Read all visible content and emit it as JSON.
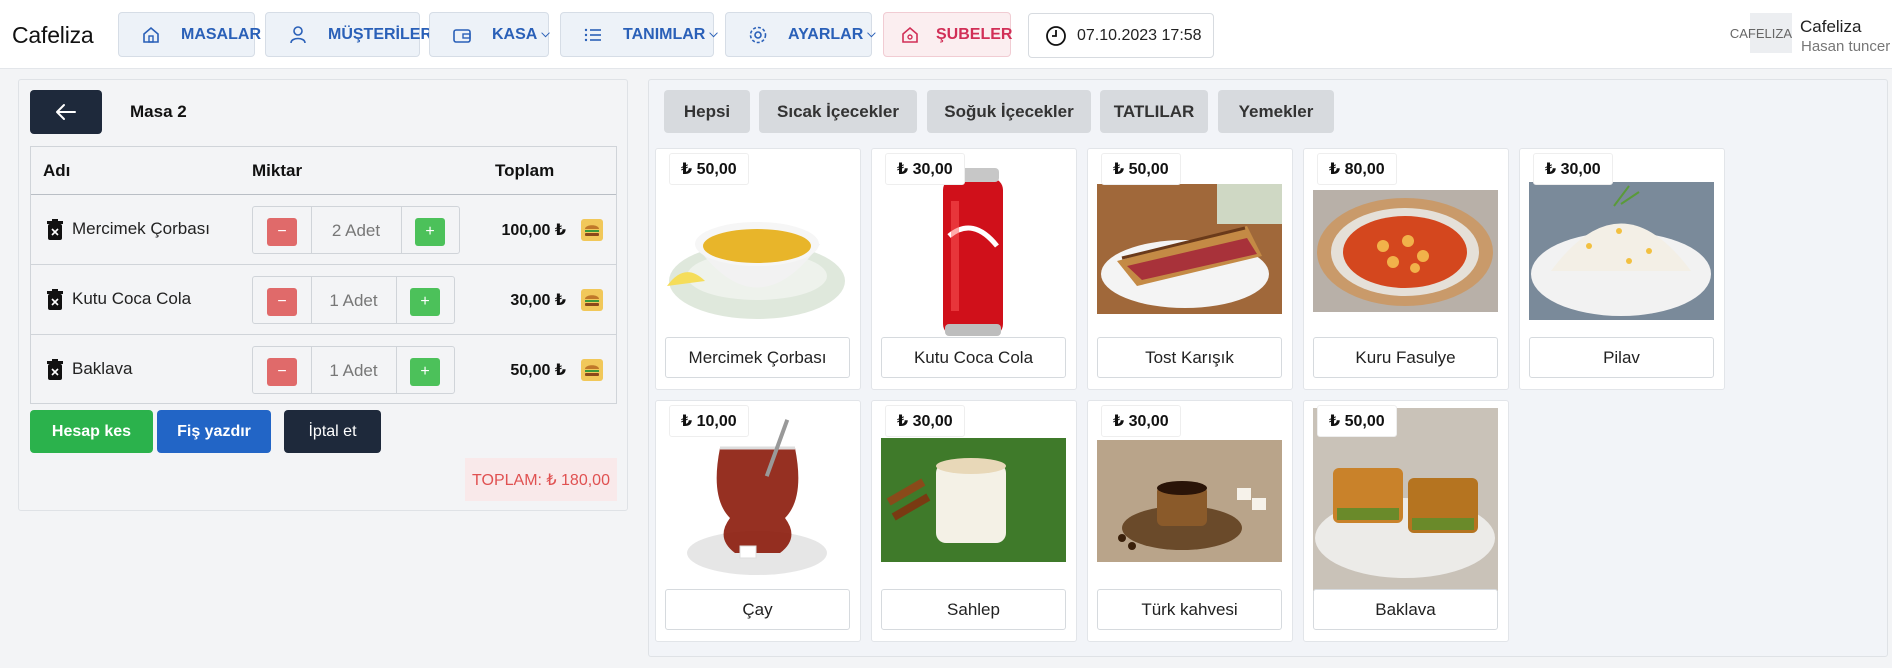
{
  "header": {
    "brand": "Cafeliza",
    "nav": [
      {
        "label": "MASALAR",
        "icon": "home-icon",
        "chevron": false
      },
      {
        "label": "MÜŞTERİLER",
        "icon": "user-icon",
        "chevron": false
      },
      {
        "label": "KASA",
        "icon": "wallet-icon",
        "chevron": true
      },
      {
        "label": "TANIMLAR",
        "icon": "list-icon",
        "chevron": true
      },
      {
        "label": "AYARLAR",
        "icon": "gear-icon",
        "chevron": true
      },
      {
        "label": "ŞUBELER",
        "icon": "home-icon",
        "chevron": false
      }
    ],
    "chevron": "⌵",
    "datetime": "07.10.2023 17:58",
    "avatar_text": "CAFELIZA",
    "user_name": "Cafeliza",
    "user_sub": "Hasan tuncer"
  },
  "order": {
    "table_name": "Masa 2",
    "columns": {
      "name": "Adı",
      "qty": "Miktar",
      "total": "Toplam"
    },
    "items": [
      {
        "name": "Mercimek Çorbası",
        "qty": "2  Adet",
        "total": "100,00 ₺"
      },
      {
        "name": "Kutu Coca Cola",
        "qty": "1  Adet",
        "total": "30,00 ₺"
      },
      {
        "name": "Baklava",
        "qty": "1  Adet",
        "total": "50,00 ₺"
      }
    ],
    "minus": "−",
    "plus": "+",
    "actions": {
      "checkout": "Hesap kes",
      "print": "Fiş yazdır",
      "cancel": "İptal et"
    },
    "grand_total": "TOPLAM: ₺ 180,00"
  },
  "menu": {
    "categories": [
      "Hepsi",
      "Sıcak İçecekler",
      "Soğuk İçecekler",
      "TATLILAR",
      "Yemekler"
    ],
    "products": [
      {
        "name": "Mercimek Çorbası",
        "price": "₺ 50,00"
      },
      {
        "name": "Kutu Coca Cola",
        "price": "₺ 30,00"
      },
      {
        "name": "Tost Karışık",
        "price": "₺ 50,00"
      },
      {
        "name": "Kuru Fasulye",
        "price": "₺ 80,00"
      },
      {
        "name": "Pilav",
        "price": "₺ 30,00"
      },
      {
        "name": "Çay",
        "price": "₺ 10,00"
      },
      {
        "name": "Sahlep",
        "price": "₺ 30,00"
      },
      {
        "name": "Türk kahvesi",
        "price": "₺ 30,00"
      },
      {
        "name": "Baklava",
        "price": "₺ 50,00"
      }
    ]
  },
  "colors": {
    "primary": "#2a60b8",
    "danger": "#e05151",
    "success": "#2bb24c",
    "dark": "#1e293b"
  }
}
